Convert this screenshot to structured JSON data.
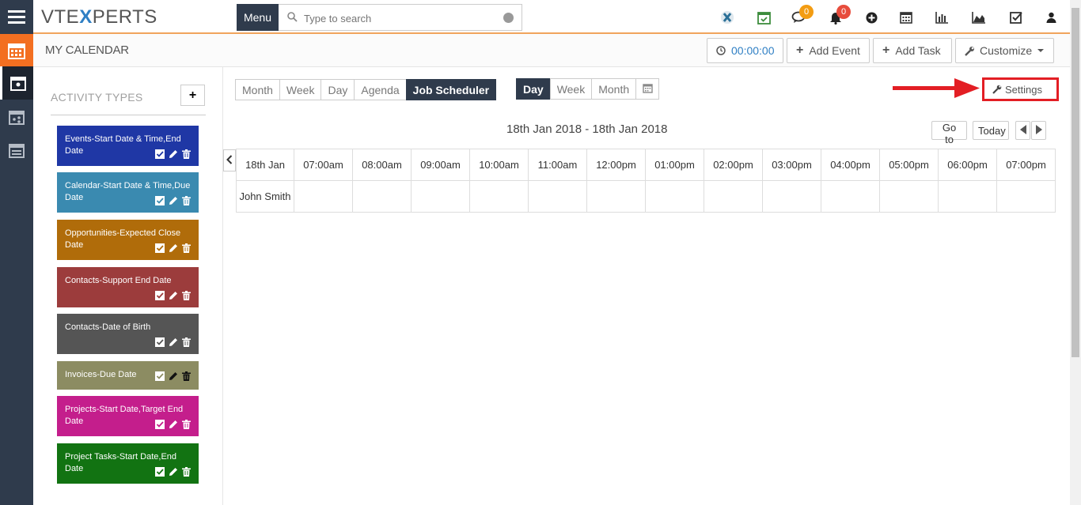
{
  "header": {
    "logo_pre": "VTE",
    "logo_x": "X",
    "logo_post": "PERTS",
    "menu_label": "Menu",
    "search_placeholder": "Type to search",
    "chat_badge": "0",
    "bell_badge": "0",
    "colors": {
      "accent": "#f36f21",
      "nav": "#2f3b4c",
      "chat_badge": "#f39c12",
      "bell_badge": "#e74c3c"
    }
  },
  "titlebar": {
    "title": "MY CALENDAR",
    "timer": "00:00:00",
    "add_event": "Add Event",
    "add_task": "Add Task",
    "customize": "Customize"
  },
  "activity_types": {
    "title": "ACTIVITY TYPES",
    "add_label": "+",
    "items": [
      {
        "label": "Events-Start Date & Time,End Date",
        "color": "#1f37a5"
      },
      {
        "label": "Calendar-Start Date & Time,Due Date",
        "color": "#3a8ab0"
      },
      {
        "label": "Opportunities-Expected Close Date",
        "color": "#b06c0a"
      },
      {
        "label": "Contacts-Support End Date",
        "color": "#9c3c3c"
      },
      {
        "label": "Contacts-Date of Birth",
        "color": "#555555"
      },
      {
        "label": "Invoices-Due Date",
        "color": "#8c8c62"
      },
      {
        "label": "Projects-Start Date,Target End Date",
        "color": "#c41e8c"
      },
      {
        "label": "Project Tasks-Start Date,End Date",
        "color": "#127312"
      }
    ]
  },
  "views": {
    "calendar_views": [
      "Month",
      "Week",
      "Day",
      "Agenda",
      "Job Scheduler"
    ],
    "selected_calendar_view": "Job Scheduler",
    "scheduler_views": [
      "Day",
      "Week",
      "Month"
    ],
    "selected_scheduler_view": "Day",
    "settings_label": "Settings"
  },
  "scheduler": {
    "range": "18th Jan 2018 - 18th Jan 2018",
    "goto_label": "Go to",
    "today_label": "Today",
    "date_header": "18th Jan",
    "time_columns": [
      "07:00am",
      "08:00am",
      "09:00am",
      "10:00am",
      "11:00am",
      "12:00pm",
      "01:00pm",
      "02:00pm",
      "03:00pm",
      "04:00pm",
      "05:00pm",
      "06:00pm",
      "07:00pm"
    ],
    "rows": [
      "John Smith"
    ]
  }
}
